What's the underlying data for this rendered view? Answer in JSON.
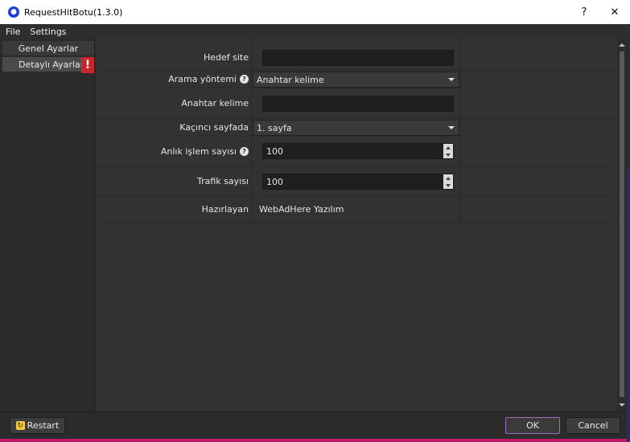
{
  "window": {
    "title": "RequestHitBotu(1.3.0)",
    "help_label": "?",
    "close_label": "✕"
  },
  "menu": [
    {
      "label": "File"
    },
    {
      "label": "Settings"
    }
  ],
  "sidebar": {
    "items": [
      {
        "label": "Genel Ayarlar"
      },
      {
        "label": "Detaylı Ayarlar",
        "badge": "!"
      }
    ]
  },
  "form": {
    "hedef_site": {
      "label": "Hedef site",
      "value": ""
    },
    "arama_yontemi": {
      "label": "Arama yöntemi",
      "selected": "Anahtar kelime",
      "help": "?"
    },
    "anahtar_kelime": {
      "label": "Anahtar kelime",
      "value": ""
    },
    "kacinci_sayfada": {
      "label": "Kaçıncı sayfada",
      "selected": "1. sayfa"
    },
    "anlik_islem": {
      "label": "Anlık işlem sayısı",
      "value": "100",
      "help": "?"
    },
    "trafik_sayisi": {
      "label": "Trafik sayısı",
      "value": "100"
    },
    "hazirlayan": {
      "label": "Hazırlayan",
      "value": "WebAdHere Yazılım"
    }
  },
  "footer": {
    "restart_label": "Restart",
    "ok_label": "OK",
    "cancel_label": "Cancel"
  },
  "colors": {
    "accent": "#9a6fc0",
    "warning": "#c8282c",
    "app_icon": "#1a3fd8"
  }
}
